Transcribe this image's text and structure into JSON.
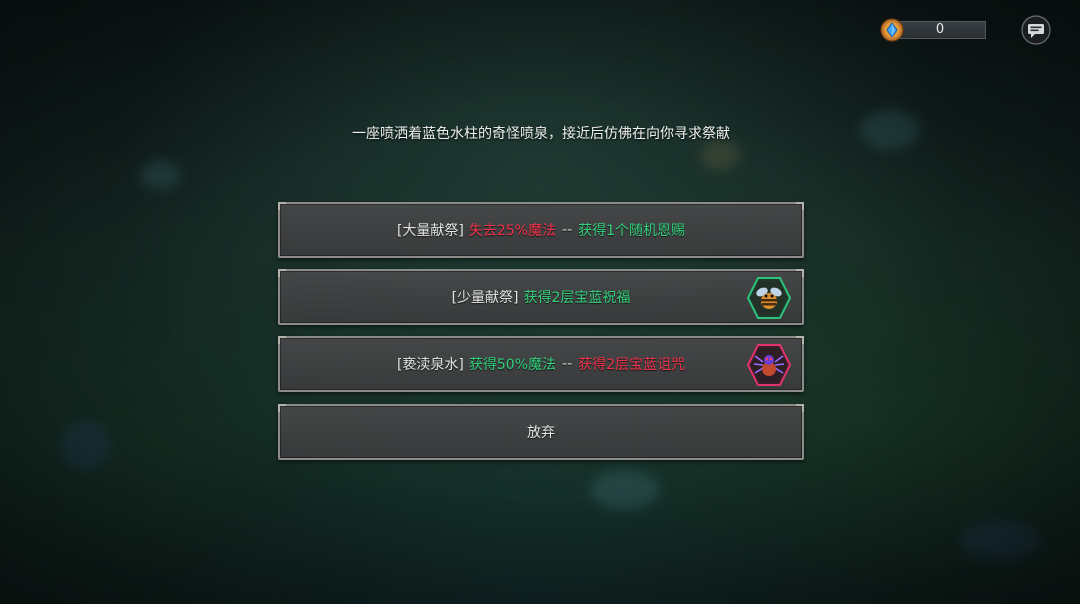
{
  "hud": {
    "currency_value": "0",
    "currency_icon": "blue-gem-icon",
    "menu_icon": "chat-menu-icon"
  },
  "event": {
    "description": "一座喷洒着蓝色水柱的奇怪喷泉，接近后仿佛在向你寻求祭献"
  },
  "choices": [
    {
      "tag": "[大量献祭]",
      "cost": "失去25%魔法",
      "separator": "--",
      "reward": "获得1个随机恩赐"
    },
    {
      "tag": "[少量献祭]",
      "reward": "获得2层宝蓝祝福",
      "badge_icon": "blessing-bee-icon"
    },
    {
      "tag": "[亵渎泉水]",
      "reward": "获得50%魔法",
      "separator": "--",
      "cost": "获得2层宝蓝诅咒",
      "badge_icon": "curse-spider-icon"
    },
    {
      "label": "放弃"
    }
  ],
  "colors": {
    "penalty": "#f0334b",
    "bonus": "#31d07a",
    "neutral": "#e4e6e6"
  }
}
